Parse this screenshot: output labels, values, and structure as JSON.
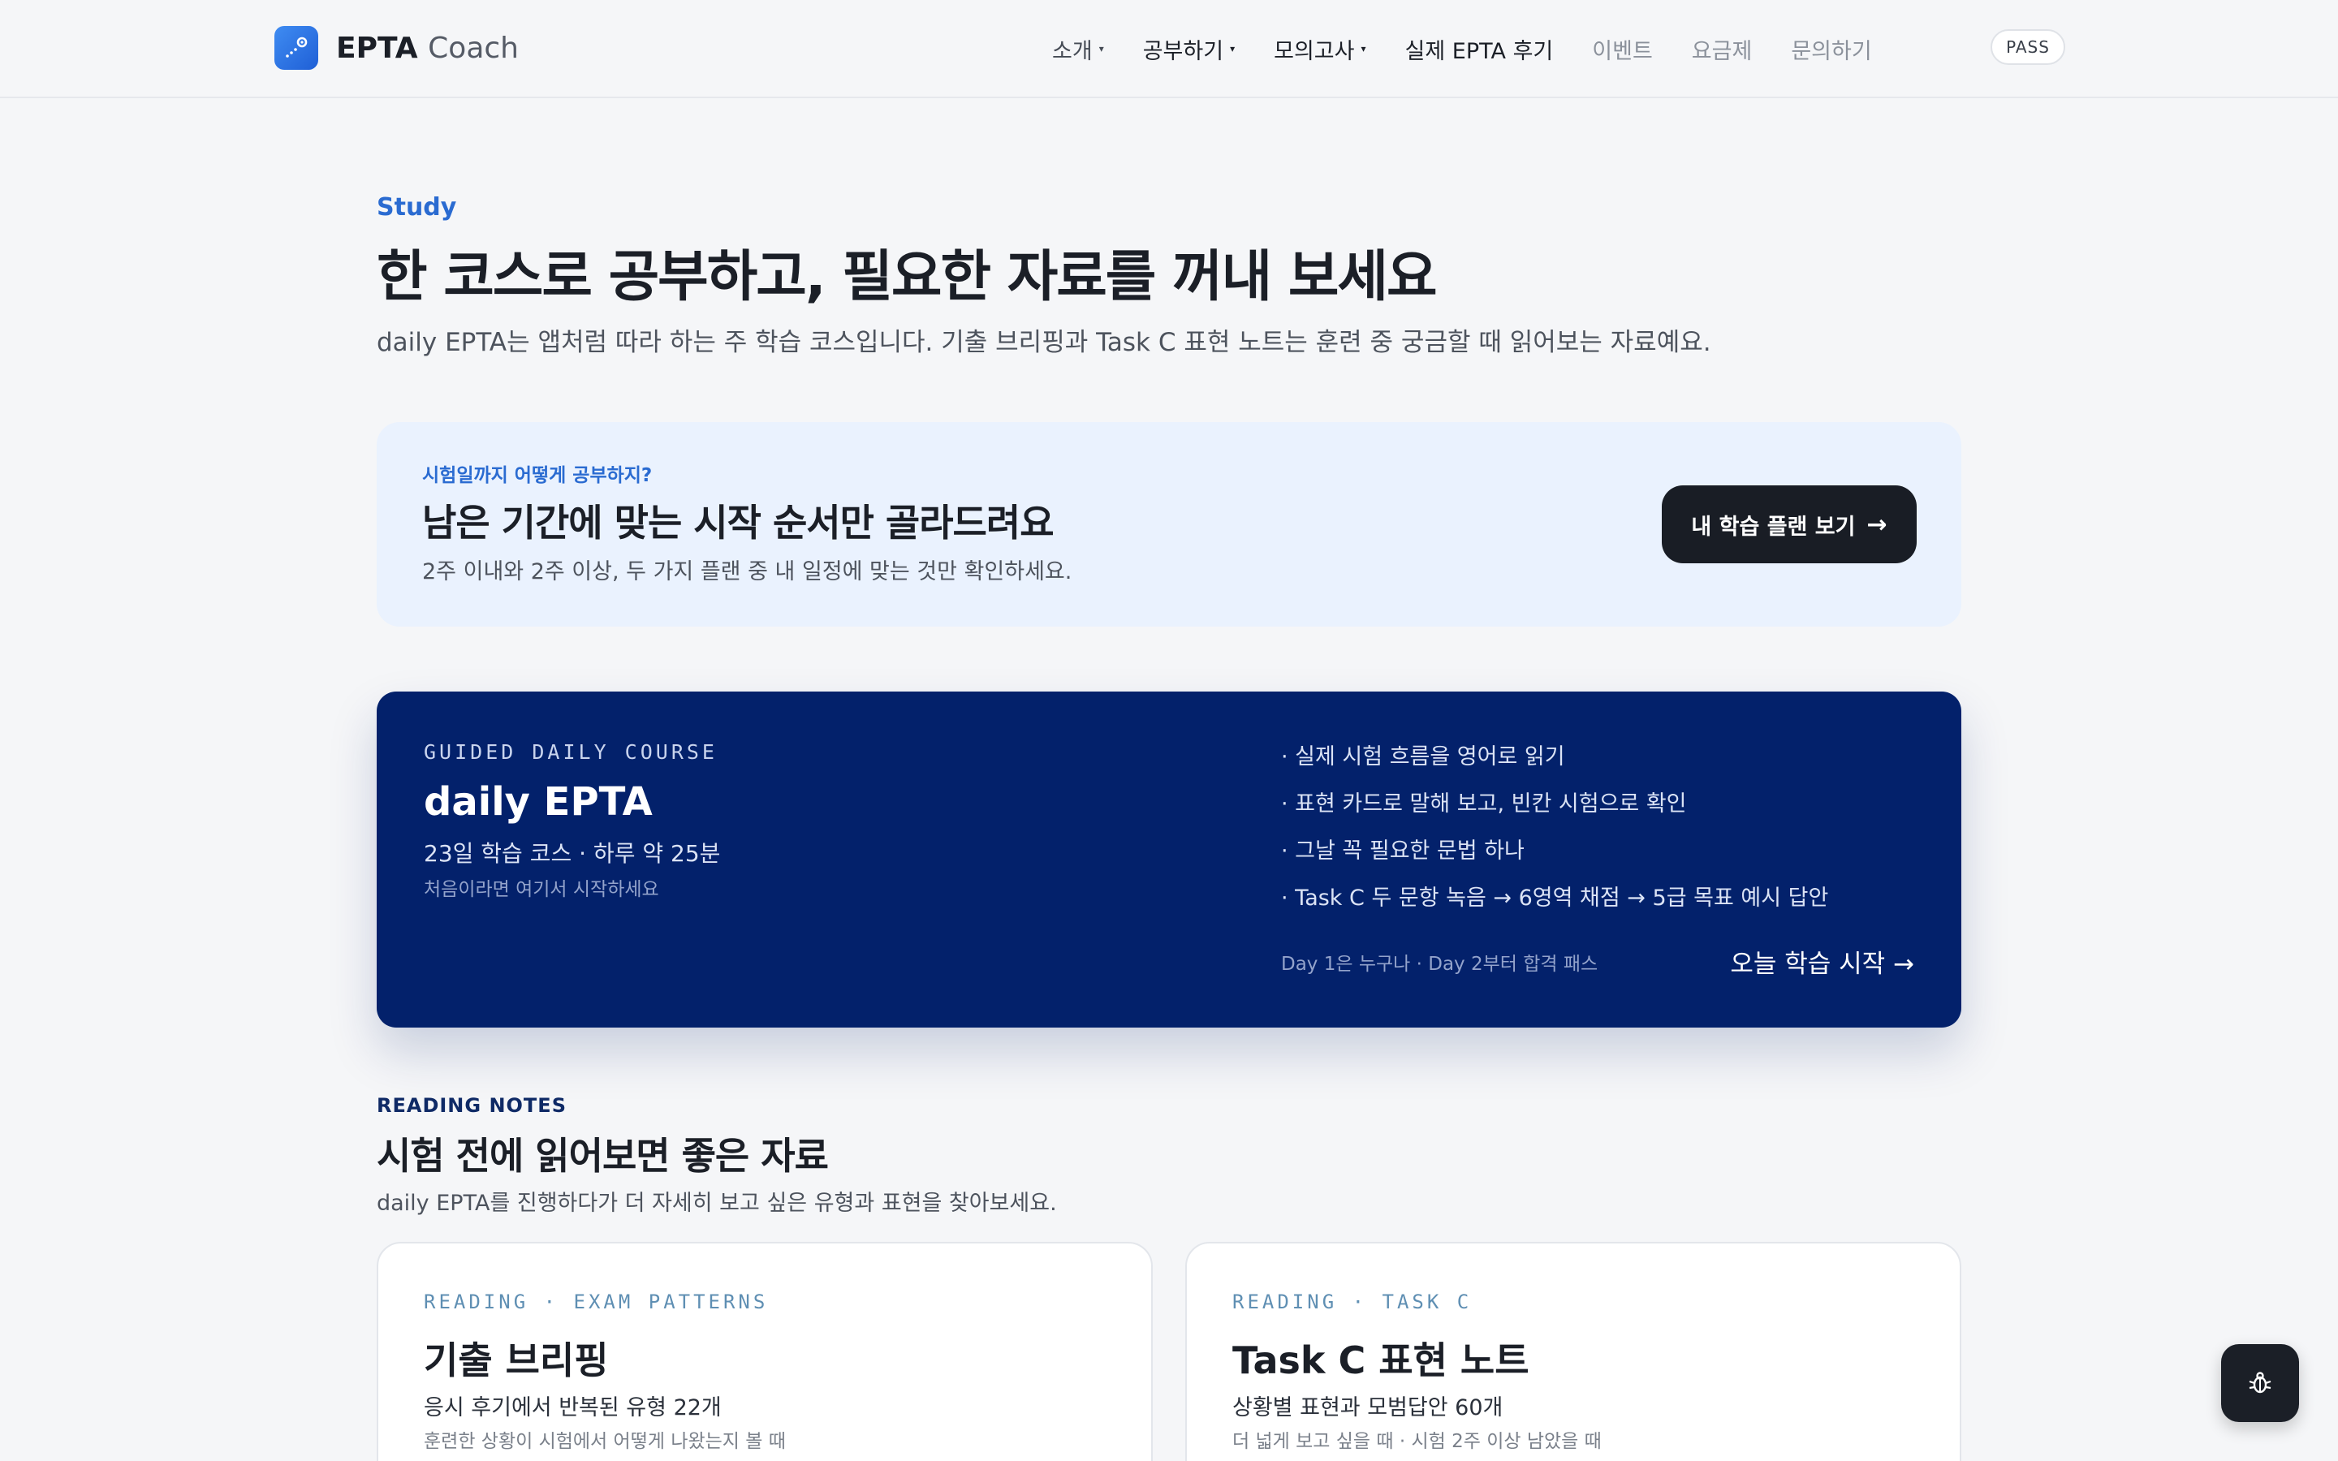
{
  "header": {
    "brand_bold": "EPTA",
    "brand_light": "Coach",
    "nav": [
      {
        "label": "소개",
        "has_caret": true
      },
      {
        "label": "공부하기",
        "has_caret": true
      },
      {
        "label": "모의고사",
        "has_caret": true
      },
      {
        "label": "실제 EPTA 후기",
        "has_caret": false
      },
      {
        "label": "이벤트",
        "has_caret": false
      },
      {
        "label": "요금제",
        "has_caret": false
      },
      {
        "label": "문의하기",
        "has_caret": false
      }
    ],
    "pass_label": "PASS"
  },
  "hero": {
    "eyebrow": "Study",
    "title": "한 코스로 공부하고, 필요한 자료를 꺼내 보세요",
    "subtitle": "daily EPTA는 앱처럼 따라 하는 주 학습 코스입니다. 기출 브리핑과 Task C 표현 노트는 훈련 중 궁금할 때 읽어보는 자료예요."
  },
  "plan": {
    "eyebrow": "시험일까지 어떻게 공부하지?",
    "title": "남은 기간에 맞는 시작 순서만 골라드려요",
    "subtitle": "2주 이내와 2주 이상, 두 가지 플랜 중 내 일정에 맞는 것만 확인하세요.",
    "button_label": "내 학습 플랜 보기",
    "button_arrow": "→"
  },
  "course": {
    "eyebrow": "GUIDED DAILY COURSE",
    "title": "daily EPTA",
    "meta": "23일 학습 코스 · 하루 약 25분",
    "note": "처음이라면 여기서 시작하세요",
    "features": [
      "· 실제 시험 흐름을 영어로 읽기",
      "· 표현 카드로 말해 보고, 빈칸 시험으로 확인",
      "· 그날 꼭 필요한 문법 하나",
      "· Task C 두 문항 녹음 → 6영역 채점 → 5급 목표 예시 답안"
    ],
    "footnote": "Day 1은 누구나 · Day 2부터 합격 패스",
    "start_label": "오늘 학습 시작 →"
  },
  "reading": {
    "eyebrow": "READING NOTES",
    "title": "시험 전에 읽어보면 좋은 자료",
    "subtitle": "daily EPTA를 진행하다가 더 자세히 보고 싶은 유형과 표현을 찾아보세요.",
    "cards": [
      {
        "eyebrow": "READING · EXAM PATTERNS",
        "title": "기출 브리핑",
        "meta": "응시 후기에서 반복된 유형 22개",
        "desc": "훈련한 상황이 시험에서 어떻게 나왔는지 볼 때"
      },
      {
        "eyebrow": "READING · TASK C",
        "title": "Task C 표현 노트",
        "meta": "상황별 표현과 모범답안 60개",
        "desc": "더 넓게 보고 싶을 때 · 시험 2주 이상 남았을 때"
      }
    ]
  },
  "colors": {
    "accent": "#2a6bd1",
    "course_bg": "#03216b",
    "dark_button": "#191d25",
    "plan_bg": "#eaf2fe"
  },
  "icons": {
    "logo": "telescope-icon",
    "debug": "bug-icon"
  }
}
